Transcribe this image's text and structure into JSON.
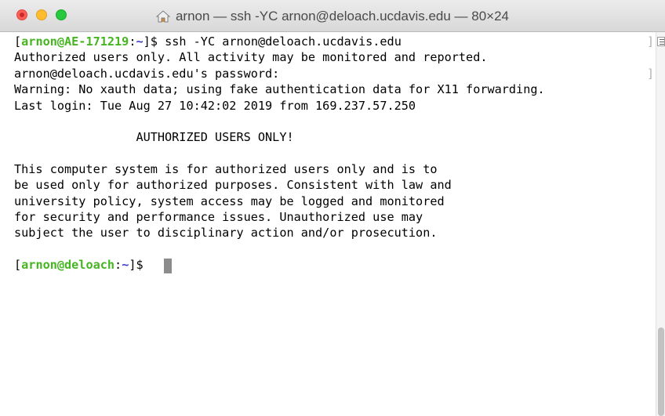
{
  "window": {
    "title": "arnon — ssh -YC arnon@deloach.ucdavis.edu — 80×24"
  },
  "terminal": {
    "line1": {
      "prompt_user_host": "arnon@AE-171219",
      "prompt_colon": ":",
      "prompt_path": "~",
      "prompt_end": "$",
      "command": "ssh -YC arnon@deloach.ucdavis.edu"
    },
    "line2": "Authorized users only. All activity may be monitored and reported.",
    "line3": "arnon@deloach.ucdavis.edu's password:",
    "line4": "Warning: No xauth data; using fake authentication data for X11 forwarding.",
    "line5": "Last login: Tue Aug 27 10:42:02 2019 from 169.237.57.250",
    "line7": "                 AUTHORIZED USERS ONLY!",
    "line9": "This computer system is for authorized users only and is to",
    "line10": "be used only for authorized purposes. Consistent with law and",
    "line11": "university policy, system access may be logged and monitored",
    "line12": "for security and performance issues. Unauthorized use may",
    "line13": "subject the user to disciplinary action and/or prosecution.",
    "line15": {
      "prompt_user_host": "arnon@deloach",
      "prompt_colon": ":",
      "prompt_path": "~",
      "prompt_end": "$"
    }
  },
  "colors": {
    "prompt_user_host": "#45b521",
    "prompt_path": "#3b3bcc",
    "close": "#fe5f57",
    "minimize": "#febc2e",
    "maximize": "#28c840"
  },
  "icons": {
    "title_icon": "home-icon",
    "scrollbar_button": "sidebar-toggle-icon"
  }
}
